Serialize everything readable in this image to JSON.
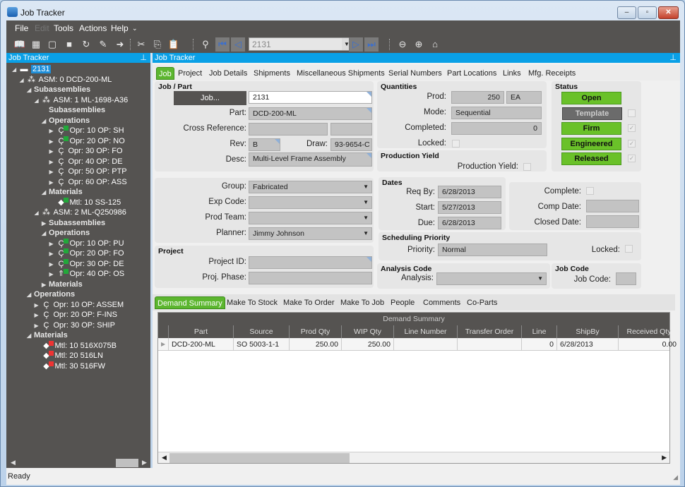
{
  "window": {
    "title": "Job Tracker",
    "minimize": "‒",
    "maximize": "▫",
    "close": "✕"
  },
  "menu": {
    "items": [
      {
        "label": "File",
        "enabled": true
      },
      {
        "label": "Edit",
        "enabled": false
      },
      {
        "label": "Tools",
        "enabled": true
      },
      {
        "label": "Actions",
        "enabled": true
      },
      {
        "label": "Help",
        "enabled": true
      }
    ],
    "overflow": "⌄"
  },
  "toolbar": {
    "job_combo_value": "2131",
    "icons": [
      "open-book-icon",
      "grid-icon",
      "note-icon",
      "square-icon",
      "refresh-icon",
      "clear-icon",
      "forward-circle-icon",
      "cut-icon",
      "copy-icon",
      "paste-icon",
      "binoculars-icon",
      "first-icon",
      "prev-icon",
      "next-icon",
      "last-icon",
      "back-icon",
      "forward-icon",
      "home-icon"
    ]
  },
  "left_panel": {
    "title": "Job Tracker",
    "pin": "⊥",
    "tree": [
      {
        "level": 0,
        "label": "2131",
        "icon": "folder",
        "toggle": "◢",
        "selected": true,
        "bold": false
      },
      {
        "level": 1,
        "label": "ASM: 0 DCD-200-ML",
        "icon": "assembly",
        "toggle": "◢"
      },
      {
        "level": 2,
        "label": "Subassemblies",
        "bold": true,
        "toggle": "◢"
      },
      {
        "level": 3,
        "label": "ASM: 1 ML-1698-A36",
        "icon": "assembly",
        "toggle": "◢"
      },
      {
        "level": 4,
        "label": "Subassemblies",
        "bold": true,
        "toggle": ""
      },
      {
        "level": 4,
        "label": "Operations",
        "bold": true,
        "toggle": "◢"
      },
      {
        "level": 5,
        "label": "Opr: 10 OP: SH",
        "icon": "operation",
        "check": "green",
        "toggle": "▶"
      },
      {
        "level": 5,
        "label": "Opr: 20 OP: NO",
        "icon": "operation",
        "check": "green",
        "toggle": "▶"
      },
      {
        "level": 5,
        "label": "Opr: 30 OP: FO",
        "icon": "operation",
        "toggle": "▶"
      },
      {
        "level": 5,
        "label": "Opr: 40 OP: DE",
        "icon": "operation",
        "toggle": "▶"
      },
      {
        "level": 5,
        "label": "Opr: 50 OP: PTP",
        "icon": "operation",
        "toggle": "▶"
      },
      {
        "level": 5,
        "label": "Opr: 60 OP: ASS",
        "icon": "operation",
        "toggle": "▶"
      },
      {
        "level": 4,
        "label": "Materials",
        "bold": true,
        "toggle": "◢"
      },
      {
        "level": 5,
        "label": "Mtl: 10 SS-125",
        "icon": "material",
        "check": "green",
        "toggle": ""
      },
      {
        "level": 3,
        "label": "ASM: 2 ML-Q250986",
        "icon": "assembly",
        "toggle": "◢"
      },
      {
        "level": 4,
        "label": "Subassemblies",
        "bold": true,
        "toggle": "▶"
      },
      {
        "level": 4,
        "label": "Operations",
        "bold": true,
        "toggle": "◢"
      },
      {
        "level": 5,
        "label": "Opr: 10 OP: PU",
        "icon": "operation",
        "check": "green",
        "toggle": "▶"
      },
      {
        "level": 5,
        "label": "Opr: 20 OP: FO",
        "icon": "operation",
        "check": "green",
        "toggle": "▶"
      },
      {
        "level": 5,
        "label": "Opr: 30 OP: DE",
        "icon": "operation",
        "check": "green",
        "toggle": "▶"
      },
      {
        "level": 5,
        "label": "Opr: 40 OP: OS",
        "icon": "subcontract",
        "check": "green",
        "toggle": "▶"
      },
      {
        "level": 4,
        "label": "Materials",
        "bold": true,
        "toggle": "▶"
      },
      {
        "level": 2,
        "label": "Operations",
        "bold": true,
        "toggle": "◢"
      },
      {
        "level": 3,
        "label": "Opr: 10 OP: ASSEM",
        "icon": "operation",
        "toggle": "▶"
      },
      {
        "level": 3,
        "label": "Opr: 20 OP: F-INS",
        "icon": "operation",
        "toggle": "▶"
      },
      {
        "level": 3,
        "label": "Opr: 30 OP: SHIP",
        "icon": "operation",
        "toggle": "▶"
      },
      {
        "level": 2,
        "label": "Materials",
        "bold": true,
        "toggle": "◢"
      },
      {
        "level": 3,
        "label": "Mtl: 10 516X075B",
        "icon": "material",
        "check": "red",
        "toggle": ""
      },
      {
        "level": 3,
        "label": "Mtl: 20 516LN",
        "icon": "material",
        "check": "red",
        "toggle": ""
      },
      {
        "level": 3,
        "label": "Mtl: 30 516FW",
        "icon": "material",
        "check": "red",
        "toggle": ""
      }
    ]
  },
  "main": {
    "title": "Job Tracker",
    "pin": "⊥",
    "tabs": [
      "Job",
      "Project",
      "Job Details",
      "Shipments",
      "Miscellaneous Shipments",
      "Serial Numbers",
      "Part Locations",
      "Links",
      "Mfg. Receipts"
    ],
    "active_tab": "Job",
    "job_part": {
      "title": "Job / Part",
      "job_button": "Job...",
      "job_value": "2131",
      "part_label": "Part:",
      "part_value": "DCD-200-ML",
      "crossref_label": "Cross Reference:",
      "crossref_value": "",
      "crossref_value2": "",
      "rev_label": "Rev:",
      "rev_value": "B",
      "draw_label": "Draw:",
      "draw_value": "93-9654-C",
      "desc_label": "Desc:",
      "desc_value": "Multi-Level Frame Assembly"
    },
    "quantities": {
      "title": "Quantities",
      "prod_label": "Prod:",
      "prod_value": "250",
      "uom": "EA",
      "mode_label": "Mode:",
      "mode_value": "Sequential",
      "completed_label": "Completed:",
      "completed_value": "0",
      "locked_label": "Locked:",
      "locked": false
    },
    "production_yield": {
      "title": "Production Yield",
      "label": "Production Yield:",
      "checked": false
    },
    "status": {
      "title": "Status",
      "buttons": [
        {
          "label": "Open",
          "active": true
        },
        {
          "label": "Template",
          "active": false,
          "checked": false
        },
        {
          "label": "Firm",
          "active": true,
          "checked": true
        },
        {
          "label": "Engineered",
          "active": true,
          "checked": true
        },
        {
          "label": "Released",
          "active": true,
          "checked": true
        }
      ]
    },
    "classification": {
      "group_label": "Group:",
      "group_value": "Fabricated",
      "exp_label": "Exp Code:",
      "exp_value": "",
      "team_label": "Prod Team:",
      "team_value": "",
      "planner_label": "Planner:",
      "planner_value": "Jimmy Johnson"
    },
    "project": {
      "title": "Project",
      "id_label": "Project ID:",
      "id_value": "",
      "phase_label": "Proj. Phase:",
      "phase_value": ""
    },
    "dates": {
      "title": "Dates",
      "reqby_label": "Req By:",
      "reqby_value": "6/28/2013",
      "start_label": "Start:",
      "start_value": "5/27/2013",
      "due_label": "Due:",
      "due_value": "6/28/2013",
      "complete_label": "Complete:",
      "complete_checked": false,
      "compdate_label": "Comp Date:",
      "compdate_value": "",
      "closed_label": "Closed Date:",
      "closed_value": ""
    },
    "scheduling": {
      "title": "Scheduling Priority",
      "priority_label": "Priority:",
      "priority_value": "Normal",
      "locked_label": "Locked:",
      "locked": false
    },
    "analysis": {
      "title": "Analysis Code",
      "label": "Analysis:",
      "value": ""
    },
    "job_code": {
      "title": "Job Code",
      "label": "Job Code:",
      "value": ""
    },
    "subtabs": [
      "Demand Summary",
      "Make To Stock",
      "Make To Order",
      "Make To Job",
      "People",
      "Comments",
      "Co-Parts"
    ],
    "active_subtab": "Demand Summary",
    "grid": {
      "caption": "Demand Summary",
      "columns": [
        "Part",
        "Source",
        "Prod Qty",
        "WIP Qty",
        "Line Number",
        "Transfer Order",
        "Line",
        "ShipBy",
        "Received Qty"
      ],
      "rows": [
        [
          "DCD-200-ML",
          "SO 5003-1-1",
          "250.00",
          "250.00",
          "",
          "",
          "0",
          "6/28/2013",
          "0.00"
        ]
      ]
    }
  },
  "statusbar": {
    "text": "Ready"
  }
}
